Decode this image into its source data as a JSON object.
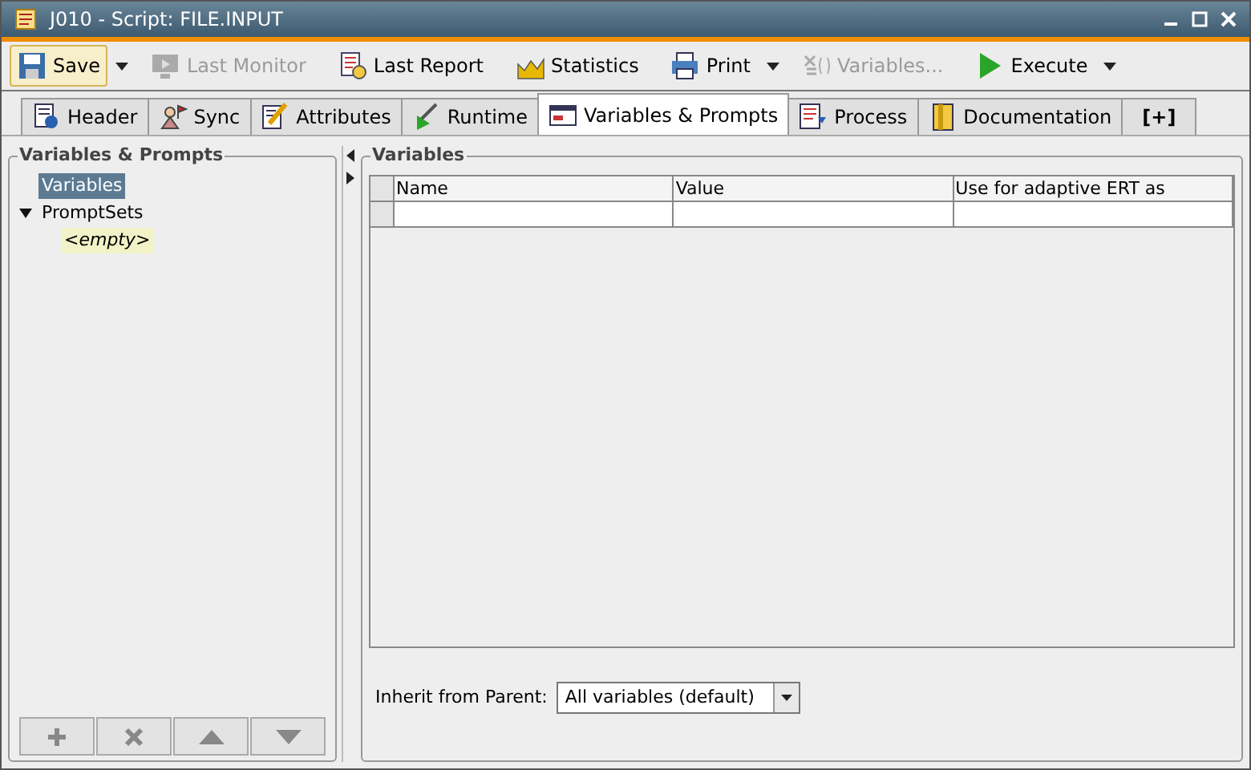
{
  "window": {
    "title": "J010 - Script: FILE.INPUT"
  },
  "toolbar": [
    {
      "kind": "save",
      "label": "Save",
      "focused": true,
      "disabled": false,
      "menu": true
    },
    {
      "kind": "monitor",
      "label": "Last Monitor",
      "focused": false,
      "disabled": true,
      "menu": false
    },
    {
      "kind": "report",
      "label": "Last Report",
      "focused": false,
      "disabled": false,
      "menu": false
    },
    {
      "kind": "statistics",
      "label": "Statistics",
      "focused": false,
      "disabled": false,
      "menu": false
    },
    {
      "kind": "print",
      "label": "Print",
      "focused": false,
      "disabled": false,
      "menu": true
    },
    {
      "kind": "variables",
      "label": "Variables...",
      "focused": false,
      "disabled": true,
      "menu": false
    },
    {
      "kind": "execute",
      "label": "Execute",
      "focused": false,
      "disabled": false,
      "menu": true
    }
  ],
  "tabs": [
    {
      "kind": "header",
      "label": "Header",
      "selected": false
    },
    {
      "kind": "sync",
      "label": "Sync",
      "selected": false
    },
    {
      "kind": "attributes",
      "label": "Attributes",
      "selected": false
    },
    {
      "kind": "runtime",
      "label": "Runtime",
      "selected": false
    },
    {
      "kind": "variables",
      "label": "Variables & Prompts",
      "selected": true
    },
    {
      "kind": "process",
      "label": "Process",
      "selected": false
    },
    {
      "kind": "documentation",
      "label": "Documentation",
      "selected": false
    },
    {
      "kind": "add",
      "label": "[+]",
      "selected": false
    }
  ],
  "left_panel": {
    "title": "Variables & Prompts",
    "tree": [
      {
        "label": "Variables",
        "selected": true
      },
      {
        "label": "PromptSets",
        "selected": false,
        "expanded": true,
        "children": [
          {
            "label": "<empty>",
            "selected": false
          }
        ]
      }
    ]
  },
  "right_panel": {
    "title": "Variables",
    "table": {
      "columns": [
        "Name",
        "Value",
        "Use for adaptive ERT as"
      ]
    },
    "inherit": {
      "label": "Inherit from Parent:",
      "value": "All variables (default)"
    }
  }
}
